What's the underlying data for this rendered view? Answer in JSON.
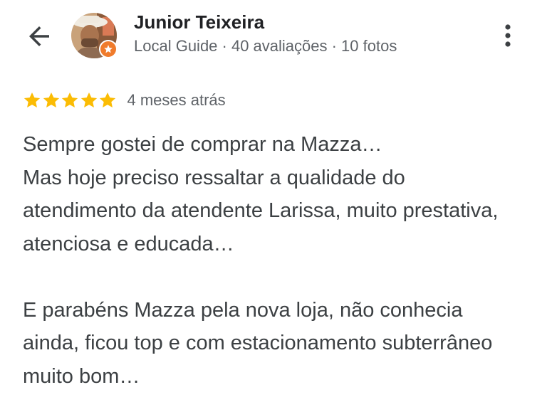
{
  "header": {
    "user_name": "Junior Teixeira",
    "user_meta": "Local Guide · 40 avaliações · 10 fotos",
    "back_icon": "arrow-back-icon",
    "more_icon": "more-vert-icon",
    "badge_icon": "local-guide-star-icon",
    "badge_color": "#f07b2b"
  },
  "review": {
    "rating": 5,
    "rating_max": 5,
    "star_color": "#fbbc04",
    "date": "4 meses atrás",
    "text": "Sempre gostei de comprar na Mazza…\nMas hoje preciso ressaltar a qualidade do atendimento da atendente Larissa, muito prestativa, atenciosa e educada…\n\nE parabéns Mazza pela nova loja, não conhecia ainda, ficou top e com estacionamento subterrâneo muito bom…"
  }
}
